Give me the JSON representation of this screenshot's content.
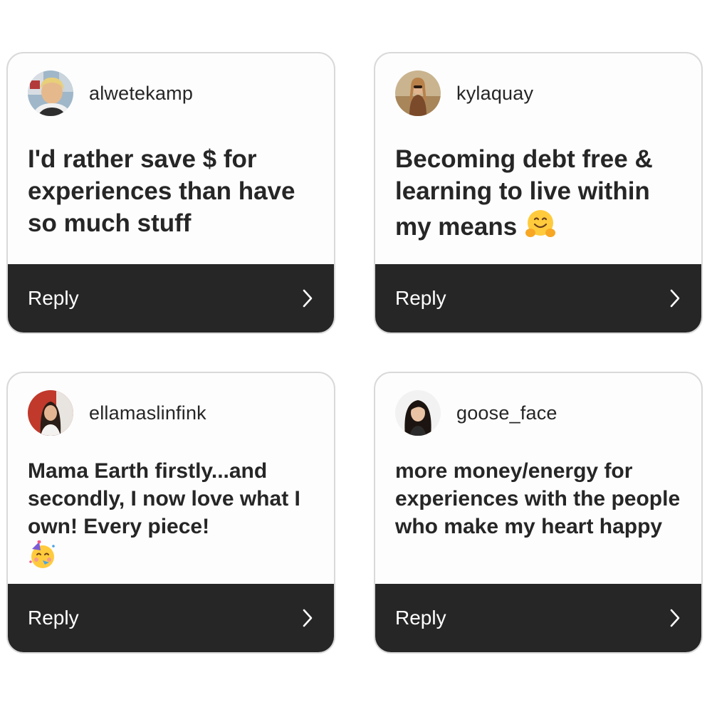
{
  "cards": [
    {
      "username": "alwetekamp",
      "text": "I'd rather save $ for experiences than have so much stuff",
      "reply_label": "Reply",
      "avatar": "avatar-photo"
    },
    {
      "username": "kylaquay",
      "text": "Becoming debt free & learning to live within my means",
      "emoji": "hugging-face-emoji",
      "reply_label": "Reply",
      "avatar": "avatar-photo"
    },
    {
      "username": "ellamaslinfink",
      "text": "Mama Earth firstly...and secondly, I now love what I own! Every piece!",
      "emoji": "partying-face-emoji",
      "reply_label": "Reply",
      "avatar": "avatar-photo"
    },
    {
      "username": "goose_face",
      "text": "more money/energy for experiences with the people who make my heart happy",
      "reply_label": "Reply",
      "avatar": "avatar-photo"
    }
  ],
  "icons": {
    "reply_chevron": "chevron-right-icon"
  },
  "colors": {
    "reply_bar": "#262626",
    "card_border": "#d9d9d9",
    "text": "#262626"
  }
}
